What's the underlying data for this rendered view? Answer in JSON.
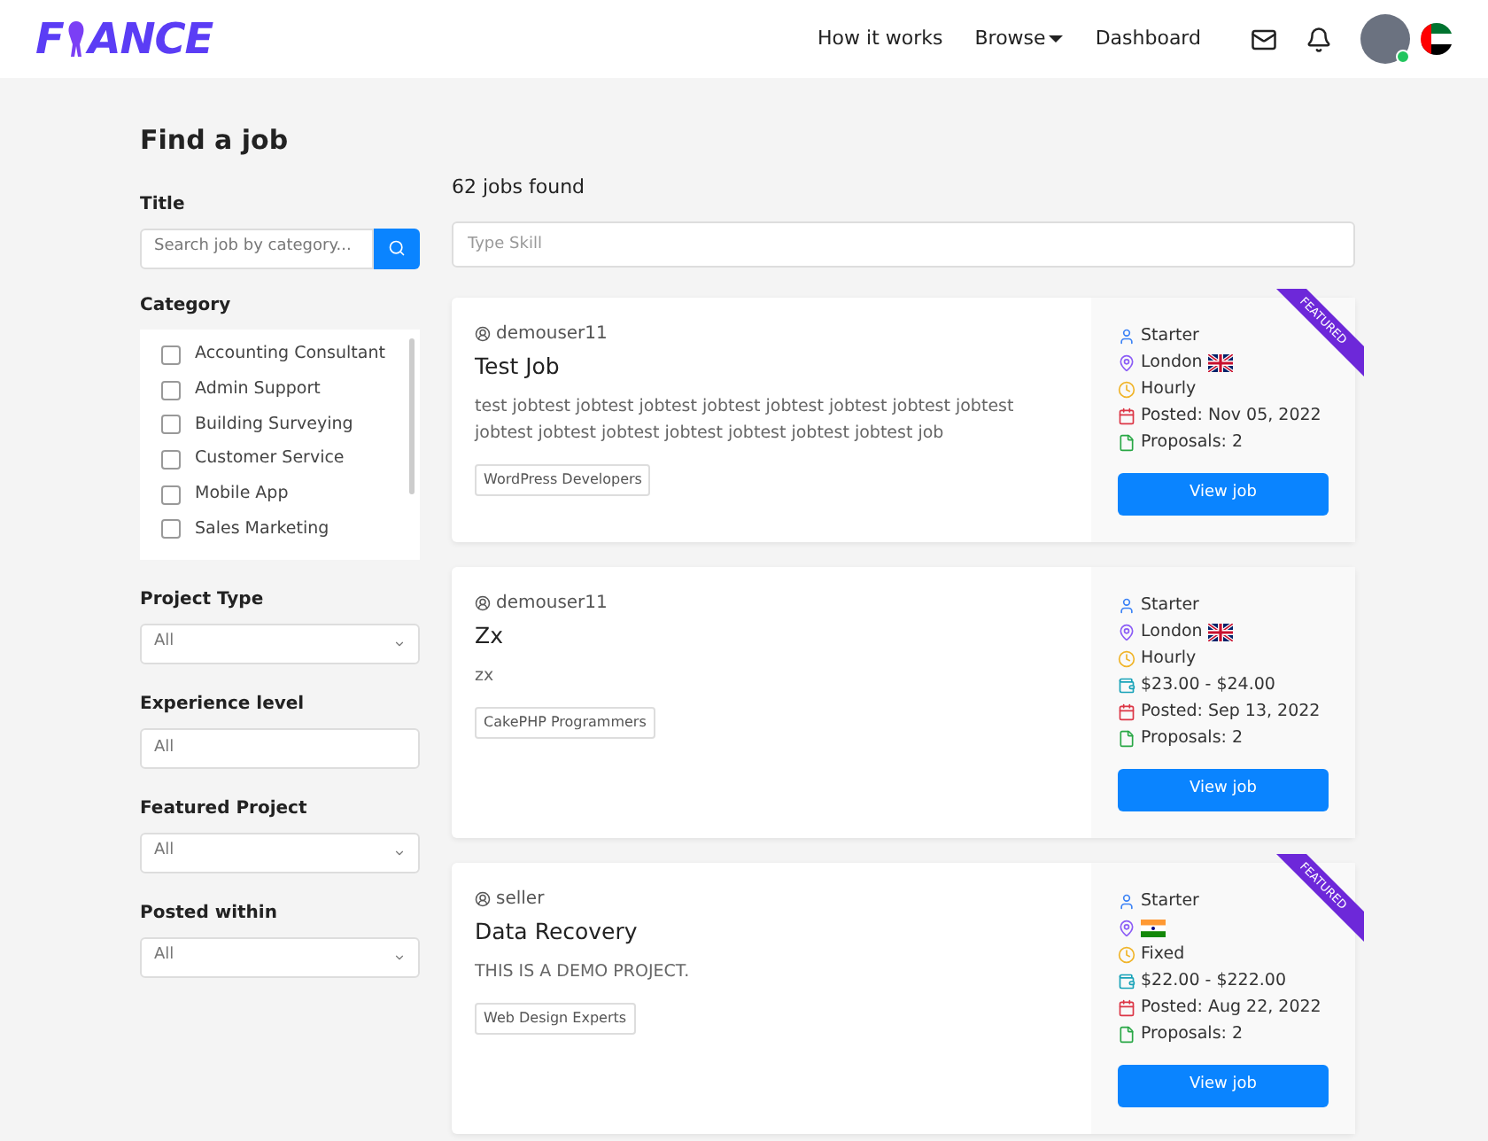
{
  "header": {
    "logo": [
      "F",
      "ANCE"
    ],
    "nav": [
      {
        "label": "How it works",
        "dropdown": false
      },
      {
        "label": "Browse",
        "dropdown": true
      },
      {
        "label": "Dashboard",
        "dropdown": false
      }
    ],
    "avatar_online": true
  },
  "sidebar": {
    "heading": "Find a job",
    "title_label": "Title",
    "search_placeholder": "Search job by category...",
    "category_label": "Category",
    "categories": [
      {
        "label": "Accounting Consultant",
        "checked": false
      },
      {
        "label": "Admin Support",
        "checked": false
      },
      {
        "label": "Building Surveying",
        "checked": false
      },
      {
        "label": "Customer Service",
        "checked": false
      },
      {
        "label": "Mobile App",
        "checked": false
      },
      {
        "label": "Sales Marketing",
        "checked": false
      }
    ],
    "filters": [
      {
        "label": "Project Type",
        "value": "All",
        "kind": "select"
      },
      {
        "label": "Experience level",
        "value": "All",
        "kind": "input"
      },
      {
        "label": "Featured Project",
        "value": "All",
        "kind": "select"
      },
      {
        "label": "Posted within",
        "value": "All",
        "kind": "select"
      }
    ]
  },
  "results": {
    "count": "62 jobs found",
    "skill_placeholder": "Type Skill",
    "jobs": [
      {
        "featured_label": "FEATURED",
        "button_label": "View job",
        "user": "demouser11",
        "title": "Test Job",
        "description": "test jobtest jobtest jobtest jobtest jobtest jobtest jobtest jobtest jobtest jobtest jobtest jobtest jobtest jobtest jobtest job",
        "tag": "WordPress Developers",
        "meta": [
          {
            "kind": "level",
            "text": "Starter"
          },
          {
            "kind": "location",
            "text": "London",
            "flag": {
              "kind": "uk"
            }
          },
          {
            "kind": "type",
            "text": "Hourly"
          },
          {
            "kind": "posted",
            "text": "Posted: Nov 05, 2022"
          },
          {
            "kind": "proposals",
            "text": "Proposals: 2"
          }
        ]
      },
      {
        "button_label": "View job",
        "user": "demouser11",
        "title": "Zx",
        "description": "zx",
        "tag": "CakePHP Programmers",
        "meta": [
          {
            "kind": "level",
            "text": "Starter"
          },
          {
            "kind": "location",
            "text": "London",
            "flag": {
              "kind": "uk"
            }
          },
          {
            "kind": "type",
            "text": "Hourly"
          },
          {
            "kind": "price",
            "text": "$23.00 - $24.00"
          },
          {
            "kind": "posted",
            "text": "Posted: Sep 13, 2022"
          },
          {
            "kind": "proposals",
            "text": "Proposals: 2"
          }
        ]
      },
      {
        "featured_label": "FEATURED",
        "button_label": "View job",
        "user": "seller",
        "title": "Data Recovery",
        "description": "THIS IS A DEMO PROJECT.",
        "tag": "Web Design Experts",
        "meta": [
          {
            "kind": "level",
            "text": "Starter"
          },
          {
            "kind": "location",
            "flag": {
              "kind": "in"
            }
          },
          {
            "kind": "type",
            "text": "Fixed"
          },
          {
            "kind": "price",
            "text": "$22.00 - $222.00"
          },
          {
            "kind": "posted",
            "text": "Posted: Aug 22, 2022"
          },
          {
            "kind": "proposals",
            "text": "Proposals: 2"
          }
        ]
      }
    ]
  }
}
